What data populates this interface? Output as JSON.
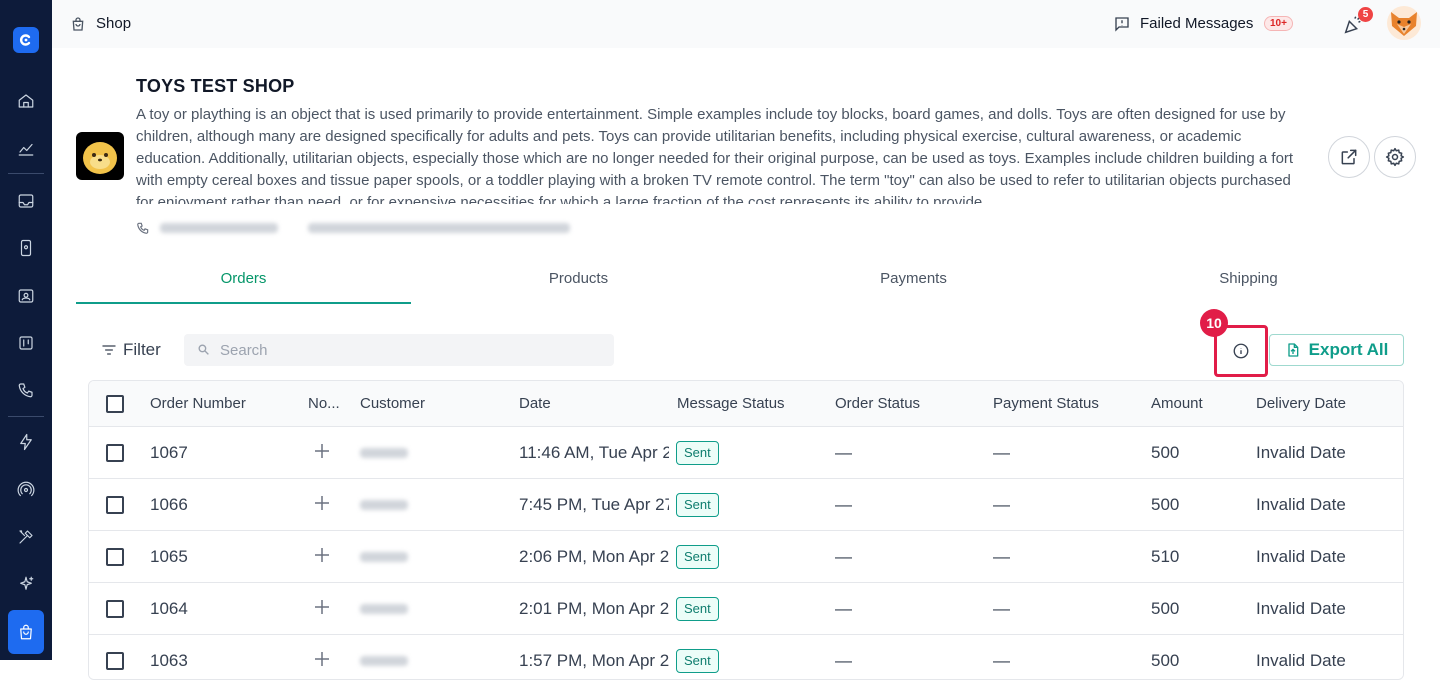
{
  "sidebar": {
    "items": [
      "logo-icon",
      "home-icon",
      "analytics-icon",
      "inbox-icon",
      "device-icon",
      "contacts-icon",
      "board-icon",
      "phone-icon",
      "flash-icon",
      "broadcast-icon",
      "tools-icon",
      "sparkle-icon",
      "shop-icon"
    ],
    "active": "shop-icon"
  },
  "topbar": {
    "breadcrumb": "Shop",
    "failed_messages_label": "Failed Messages",
    "failed_messages_count": "10+",
    "notifications_count": "5"
  },
  "shop": {
    "title": "TOYS TEST SHOP",
    "description": "A toy or plaything is an object that is used primarily to provide entertainment. Simple examples include toy blocks, board games, and dolls. Toys are often designed for use by children, although many are designed specifically for adults and pets. Toys can provide utilitarian benefits, including physical exercise, cultural awareness, or academic education. Additionally, utilitarian objects, especially those which are no longer needed for their original purpose, can be used as toys. Examples include children building a fort with empty cereal boxes and tissue paper spools, or a toddler playing with a broken TV remote control. The term \"toy\" can also be used to refer to utilitarian objects purchased for enjoyment rather than need, or for expensive necessities for which a large fraction of the cost represents its ability to provide"
  },
  "tabs": [
    {
      "label": "Orders",
      "active": true
    },
    {
      "label": "Products",
      "active": false
    },
    {
      "label": "Payments",
      "active": false
    },
    {
      "label": "Shipping",
      "active": false
    }
  ],
  "toolbar": {
    "filter_label": "Filter",
    "search_placeholder": "Search",
    "info_marker": "10",
    "export_label": "Export All"
  },
  "table": {
    "columns": [
      "Order Number",
      "No...",
      "Customer",
      "Date",
      "Message Status",
      "Order Status",
      "Payment Status",
      "Amount",
      "Delivery Date"
    ],
    "rows": [
      {
        "order": "1067",
        "date": "11:46 AM, Tue Apr 2",
        "status": "Sent",
        "order_status": "—",
        "payment_status": "—",
        "amount": "500",
        "delivery": "Invalid Date"
      },
      {
        "order": "1066",
        "date": "7:45 PM, Tue Apr 27",
        "status": "Sent",
        "order_status": "—",
        "payment_status": "—",
        "amount": "500",
        "delivery": "Invalid Date"
      },
      {
        "order": "1065",
        "date": "2:06 PM, Mon Apr 2",
        "status": "Sent",
        "order_status": "—",
        "payment_status": "—",
        "amount": "510",
        "delivery": "Invalid Date"
      },
      {
        "order": "1064",
        "date": "2:01 PM, Mon Apr 2",
        "status": "Sent",
        "order_status": "—",
        "payment_status": "—",
        "amount": "500",
        "delivery": "Invalid Date"
      },
      {
        "order": "1063",
        "date": "1:57 PM, Mon Apr 2",
        "status": "Sent",
        "order_status": "—",
        "payment_status": "—",
        "amount": "500",
        "delivery": "Invalid Date"
      }
    ]
  },
  "colors": {
    "sidebar_bg": "#0d1b3a",
    "accent": "#1e6bf0",
    "tab_active": "#0f9d8a",
    "highlight": "#e11d48"
  }
}
